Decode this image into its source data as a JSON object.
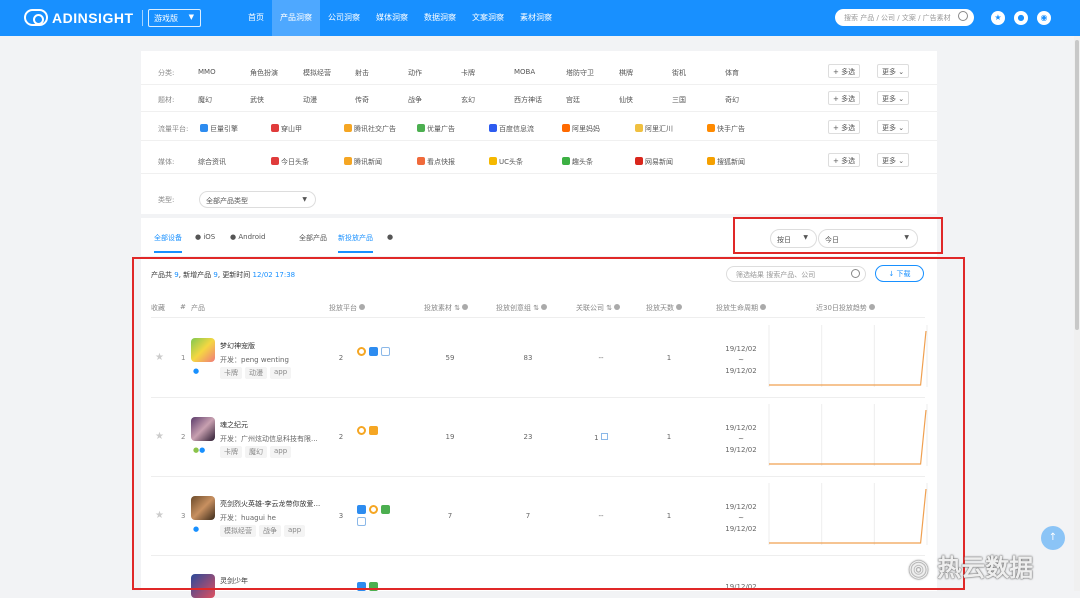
{
  "header": {
    "brand": "ADINSIGHT",
    "version_select": "游戏版",
    "nav": [
      "首页",
      "产品洞察",
      "公司洞察",
      "媒体洞察",
      "数据洞察",
      "文案洞察",
      "素材洞察"
    ],
    "nav_active": 1,
    "search_placeholder": "搜索 产品 / 公司 / 文案 / 广告素材",
    "icons": [
      "star-icon",
      "notification-icon",
      "user-icon"
    ]
  },
  "filters": {
    "rows": [
      {
        "label": "分类:",
        "options": [
          "MMO",
          "角色扮演",
          "模拟经营",
          "射击",
          "动作",
          "卡牌",
          "MOBA",
          "塔防守卫",
          "棋牌",
          "街机",
          "体育"
        ],
        "multi": "+ 多选",
        "more": "更多"
      },
      {
        "label": "题材:",
        "options": [
          "魔幻",
          "武侠",
          "动漫",
          "传奇",
          "战争",
          "玄幻",
          "西方神话",
          "宫廷",
          "仙侠",
          "三国",
          "奇幻"
        ],
        "multi": "+ 多选",
        "more": "更多"
      },
      {
        "label": "流量平台:",
        "options": [
          "巨量引擎",
          "穿山甲",
          "腾讯社交广告",
          "优量广告",
          "百度信息流",
          "阿里妈妈",
          "阿里汇川",
          "快手广告"
        ],
        "multi": "+ 多选",
        "more": "更多"
      },
      {
        "label": "媒体:",
        "options": [
          "综合资讯",
          "今日头条",
          "腾讯新闻",
          "看点快报",
          "UC头条",
          "趣头条",
          "网易新闻",
          "搜狐新闻"
        ],
        "multi": "+ 多选",
        "more": "更多"
      }
    ],
    "level_label": "类型:",
    "level_value": "全部产品类型"
  },
  "tabs": {
    "devices": [
      "全部设备",
      "iOS",
      "Android"
    ],
    "products": [
      "全部产品",
      "新投放产品"
    ],
    "period": "按日",
    "date": "今日"
  },
  "summary": {
    "p1": "产品共",
    "total": "9",
    "p2": "新增产品",
    "new": "9",
    "p3": "更新时间",
    "time": "12/02 17:38"
  },
  "table": {
    "search_placeholder": "筛选结果 搜索产品、公司",
    "download": "↓ 下载",
    "headers": [
      "收藏",
      "#",
      "产品",
      "投放平台",
      "投放素材",
      "投放创意组",
      "关联公司",
      "投放天数",
      "投放生命周期",
      "近30日投放趋势"
    ],
    "rows": [
      {
        "idx": "1",
        "name": "梦幻神宠版",
        "dev": "开发：peng wenting",
        "tags": [
          "卡牌",
          "动漫",
          "app"
        ],
        "platforms": "2",
        "materials": "59",
        "creatives": "83",
        "company": "--",
        "days": "1",
        "start": "19/12/02",
        "end": "19/12/02",
        "trend": [
          0,
          0,
          0,
          0,
          0,
          0,
          0,
          0,
          0,
          0,
          0,
          0,
          0,
          0,
          0,
          0,
          0,
          0,
          0,
          0,
          0,
          0,
          0,
          0,
          0,
          0,
          0,
          0,
          0,
          59
        ]
      },
      {
        "idx": "2",
        "name": "魂之纪元",
        "dev": "开发：广州炫动信息科技有限...",
        "tags": [
          "卡牌",
          "魔幻",
          "app"
        ],
        "platforms": "2",
        "materials": "19",
        "creatives": "23",
        "company": "1",
        "days": "1",
        "start": "19/12/02",
        "end": "19/12/02",
        "trend": [
          0,
          0,
          0,
          0,
          0,
          0,
          0,
          0,
          0,
          0,
          0,
          0,
          0,
          0,
          0,
          0,
          0,
          0,
          0,
          0,
          0,
          0,
          0,
          0,
          0,
          0,
          0,
          0,
          0,
          19
        ]
      },
      {
        "idx": "3",
        "name": "亮剑烈火英雄-李云龙带你放爱...",
        "dev": "开发：huagui he",
        "tags": [
          "模拟经营",
          "战争",
          "app"
        ],
        "platforms": "3",
        "materials": "7",
        "creatives": "7",
        "company": "--",
        "days": "1",
        "start": "19/12/02",
        "end": "19/12/02",
        "trend": [
          0,
          0,
          0,
          0,
          0,
          0,
          0,
          0,
          0,
          0,
          0,
          0,
          0,
          0,
          0,
          0,
          0,
          0,
          0,
          0,
          0,
          0,
          0,
          0,
          0,
          0,
          0,
          0,
          0,
          7
        ]
      },
      {
        "idx": "4",
        "name": "灵剑少年",
        "dev": "",
        "tags": [],
        "platforms": "",
        "materials": "",
        "creatives": "",
        "company": "",
        "days": "",
        "start": "19/12/02",
        "end": "",
        "trend": []
      }
    ]
  },
  "watermark": "热云数据",
  "colors": {
    "brand": "#1890ff",
    "highlight_box": "#e02828",
    "trend": "#f0a050"
  }
}
